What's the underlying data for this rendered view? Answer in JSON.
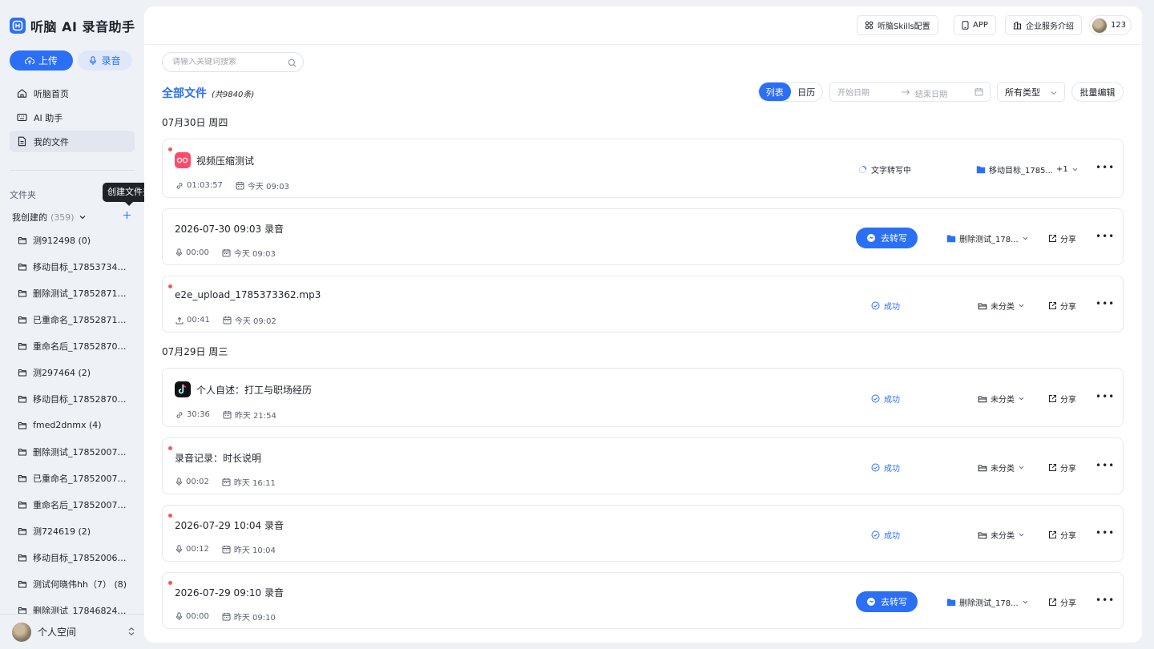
{
  "app": {
    "title": "听脑 AI 录音助手",
    "upload_label": "上传",
    "record_label": "录音"
  },
  "nav": [
    {
      "label": "听脑首页",
      "icon": "home-icon"
    },
    {
      "label": "AI 助手",
      "icon": "keyboard-icon"
    },
    {
      "label": "我的文件",
      "icon": "file-icon"
    }
  ],
  "folders_section": {
    "title": "文件夹",
    "tooltip": "创建文件夹",
    "mine_label": "我创建的",
    "mine_count": "(359)",
    "items": [
      "测912498 (0)",
      "移动目标_1785373497 ...",
      "删除测试_1785287120 ...",
      "已重命名_1785287107 (...",
      "重命名后_1785287096 ...",
      "测297464 (2)",
      "移动目标_1785287046 ...",
      "fmed2dnmx (4)",
      "删除测试_1785200743 ...",
      "已重命名_1785200729 ...",
      "重命名后_1785200720 ...",
      "测724619 (2)",
      "移动目标_1785200673 ...",
      "测试何晓伟hh（7） (8)",
      "删除测试_1784682455 ..."
    ]
  },
  "footer": {
    "space_label": "个人空间"
  },
  "topbar": {
    "skills_label": "听脑Skills配置",
    "app_label": "APP",
    "enterprise_label": "企业服务介绍",
    "user_label": "123"
  },
  "search": {
    "placeholder": "请输入关键词搜索"
  },
  "files": {
    "title": "全部文件",
    "count": "(共9840条)",
    "view_list": "列表",
    "view_calendar": "日历",
    "start_date_placeholder": "开始日期",
    "end_date_placeholder": "结束日期",
    "type_filter": "所有类型",
    "batch_edit": "批量编辑"
  },
  "groups": [
    {
      "date": "07月30日 周四"
    },
    {
      "date": "07月29日 周三"
    }
  ],
  "records": [
    {
      "title": "视频压缩测试",
      "app_icon": "kuaishou-icon",
      "duration": "01:03:57",
      "duration_icon": "link-icon",
      "time": "今天 09:03",
      "status": "文字转写中",
      "status_kind": "busy",
      "folder": "移动目标_1785...",
      "folder_extra": "+1",
      "share": "",
      "new": true
    },
    {
      "title": "2026-07-30 09:03 录音",
      "app_icon": "",
      "duration": "00:00",
      "duration_icon": "mic-icon",
      "time": "今天 09:03",
      "status": "去转写",
      "status_kind": "action",
      "folder": "删除测试_178...",
      "folder_extra": "",
      "share": "分享",
      "new": false
    },
    {
      "title": "e2e_upload_1785373362.mp3",
      "app_icon": "",
      "duration": "00:41",
      "duration_icon": "upload-icon",
      "time": "今天 09:02",
      "status": "成功",
      "status_kind": "ok",
      "folder": "未分类",
      "folder_extra": "",
      "share": "分享",
      "new": true
    },
    {
      "title": "个人自述：打工与职场经历",
      "app_icon": "douyin-icon",
      "duration": "30:36",
      "duration_icon": "link-icon",
      "time": "昨天 21:54",
      "status": "成功",
      "status_kind": "ok",
      "folder": "未分类",
      "folder_extra": "",
      "share": "分享",
      "new": false
    },
    {
      "title": "录音记录：时长说明",
      "app_icon": "",
      "duration": "00:02",
      "duration_icon": "mic-icon",
      "time": "昨天 16:11",
      "status": "成功",
      "status_kind": "ok",
      "folder": "未分类",
      "folder_extra": "",
      "share": "分享",
      "new": true
    },
    {
      "title": "2026-07-29 10:04 录音",
      "app_icon": "",
      "duration": "00:12",
      "duration_icon": "mic-icon",
      "time": "昨天 10:04",
      "status": "成功",
      "status_kind": "ok",
      "folder": "未分类",
      "folder_extra": "",
      "share": "分享",
      "new": true
    },
    {
      "title": "2026-07-29 09:10 录音",
      "app_icon": "",
      "duration": "00:00",
      "duration_icon": "mic-icon",
      "time": "昨天 09:10",
      "status": "去转写",
      "status_kind": "action",
      "folder": "删除测试_178...",
      "folder_extra": "",
      "share": "分享",
      "new": true
    }
  ],
  "colors": {
    "accent": "#2b6ff5",
    "new_dot": "#ef5b5b"
  }
}
